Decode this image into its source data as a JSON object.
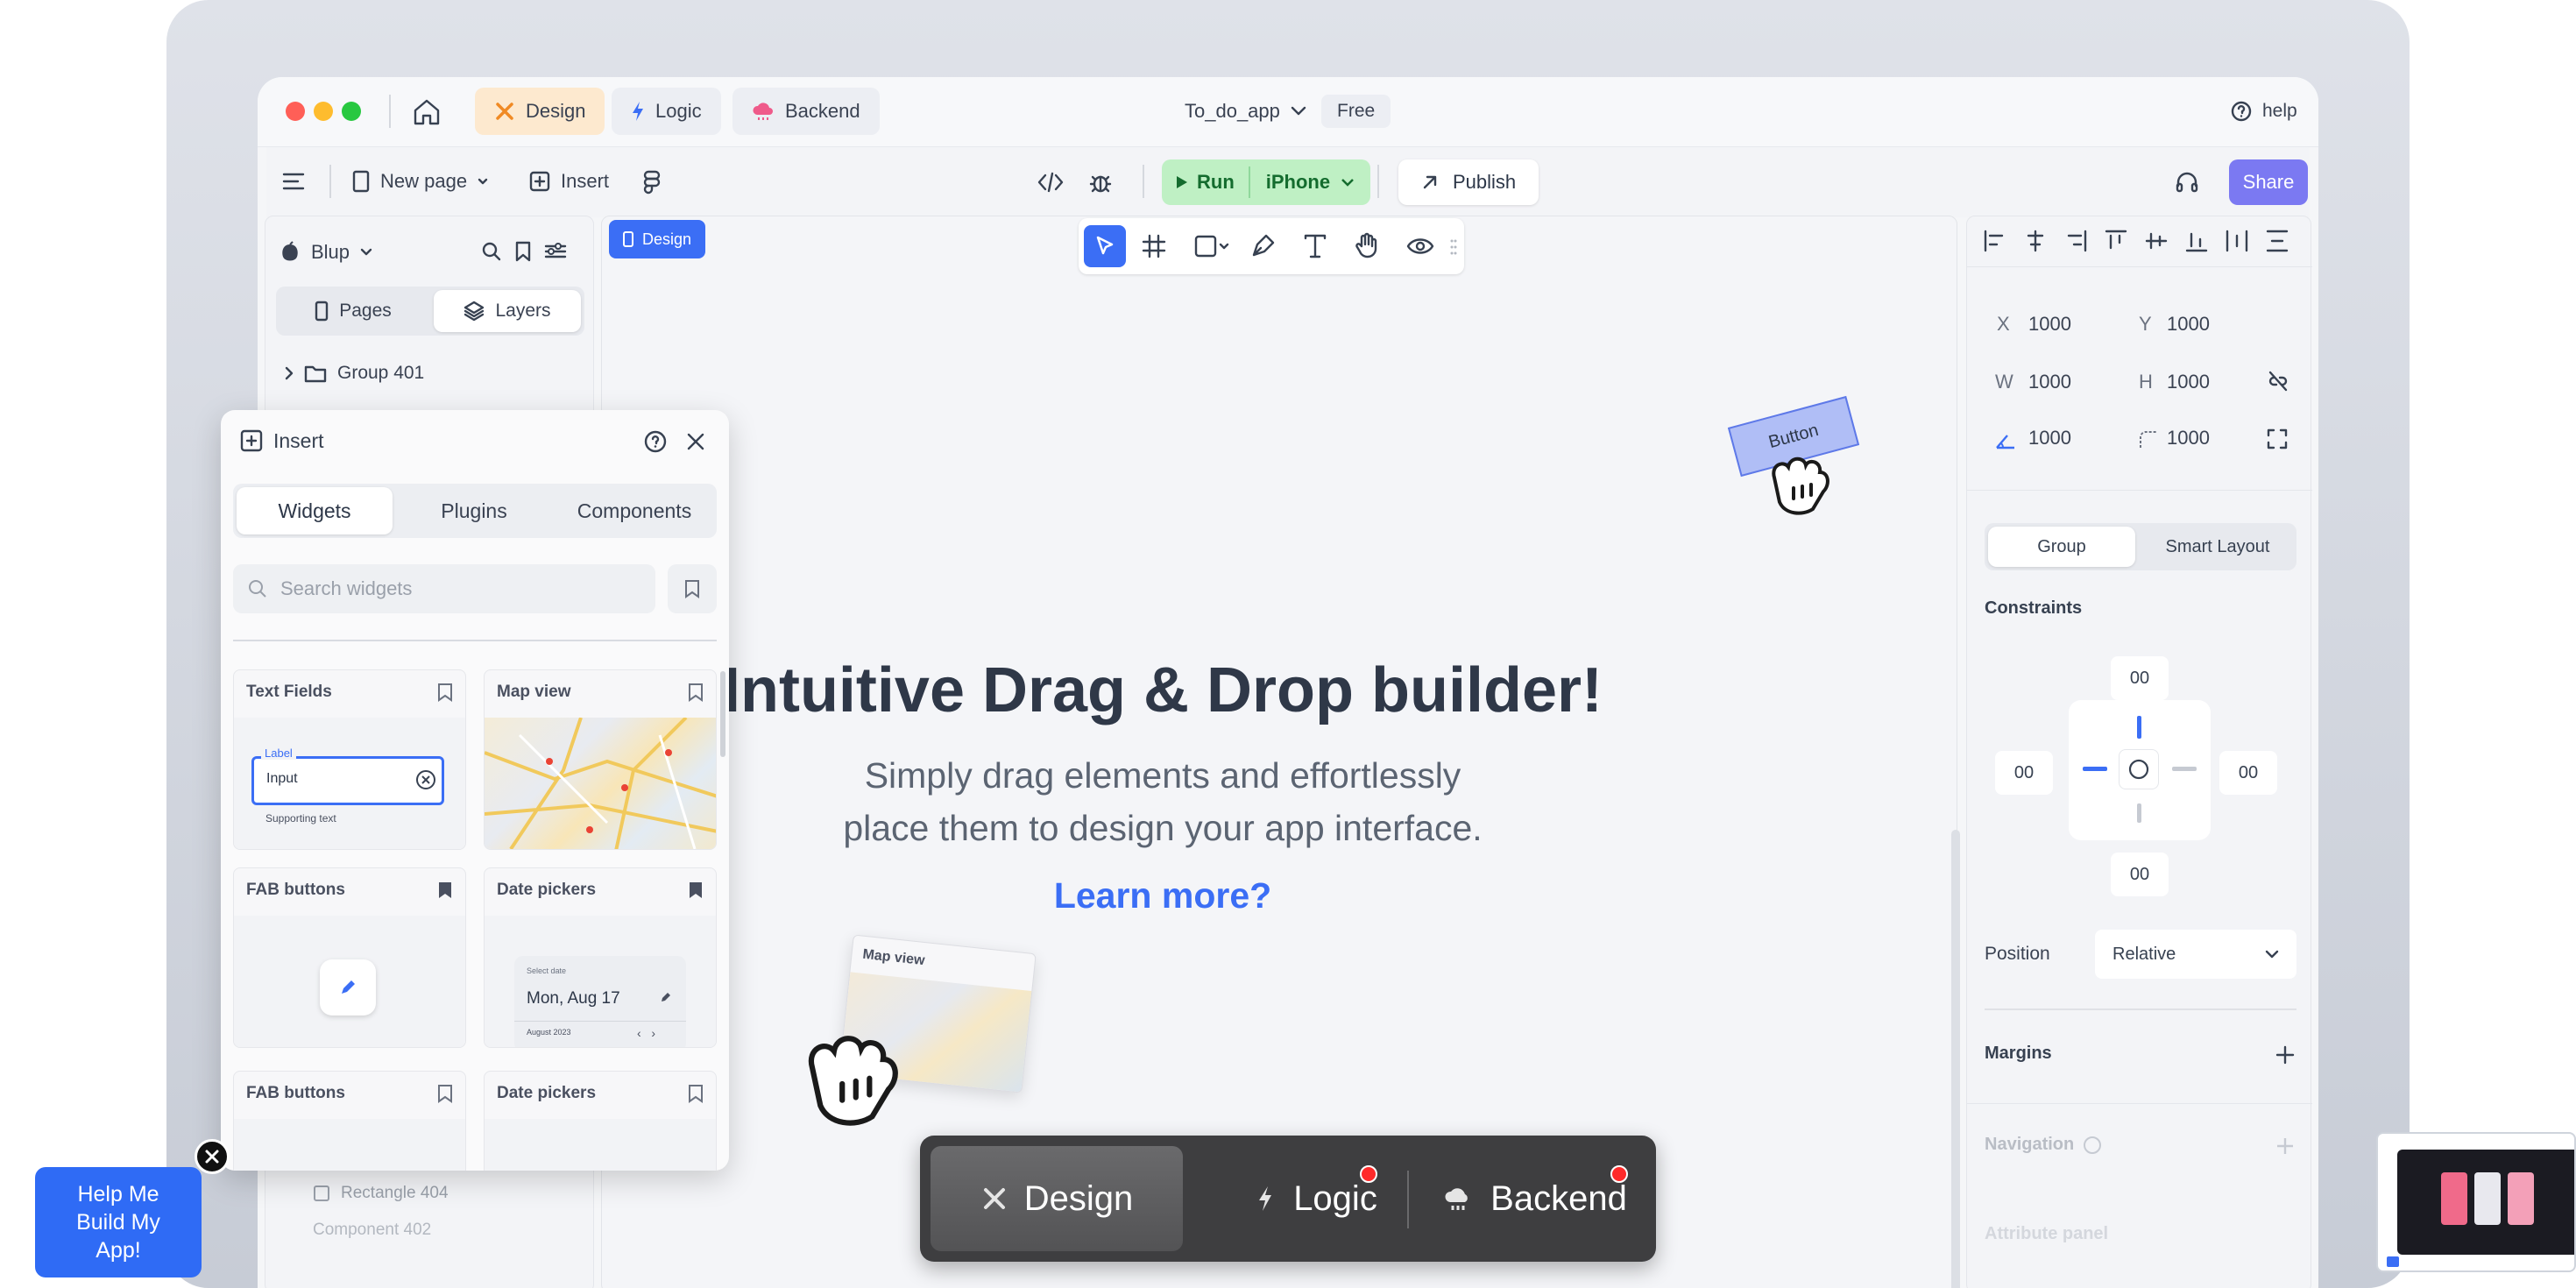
{
  "window": {
    "tabs": [
      {
        "label": "Design",
        "icon": "design-icon"
      },
      {
        "label": "Logic",
        "icon": "bolt-icon"
      },
      {
        "label": "Backend",
        "icon": "cloud-icon"
      }
    ],
    "project_name": "To_do_app",
    "plan_badge": "Free",
    "help_label": "help"
  },
  "toolbar": {
    "new_page_label": "New page",
    "insert_label": "Insert",
    "run_label": "Run",
    "device_label": "iPhone",
    "publish_label": "Publish",
    "share_label": "Share"
  },
  "left_panel": {
    "workspace": "Blup",
    "tabs": [
      "Pages",
      "Layers"
    ],
    "active_tab": "Layers",
    "layers": [
      "Group 401",
      "Rectangle 404",
      "Component 402"
    ]
  },
  "insert_panel": {
    "title": "Insert",
    "tabs": [
      "Widgets",
      "Plugins",
      "Components"
    ],
    "active_tab": "Widgets",
    "search_placeholder": "Search widgets",
    "cards": [
      {
        "title": "Text Fields",
        "bookmarked": false
      },
      {
        "title": "Map view",
        "bookmarked": false
      },
      {
        "title": "FAB buttons",
        "bookmarked": true
      },
      {
        "title": "Date pickers",
        "bookmarked": true
      },
      {
        "title": "FAB buttons",
        "bookmarked": false
      },
      {
        "title": "Date pickers",
        "bookmarked": false
      }
    ],
    "text_field_preview": {
      "label": "Label",
      "value": "Input",
      "supporting": "Supporting text"
    },
    "date_preview": {
      "caption": "Select date",
      "date": "Mon, Aug 17",
      "month": "August 2023"
    }
  },
  "canvas": {
    "badge": "Design",
    "headline": "Intuitive Drag & Drop builder!",
    "subline_1": "Simply drag elements and effortlessly",
    "subline_2": "place them to design your app interface.",
    "link": "Learn more?",
    "dragged_button_label": "Button",
    "dragged_card_title": "Map view"
  },
  "right_panel": {
    "x_label": "X",
    "x_value": "1000",
    "y_label": "Y",
    "y_value": "1000",
    "w_label": "W",
    "w_value": "1000",
    "h_label": "H",
    "h_value": "1000",
    "rotation_value": "1000",
    "radius_value": "1000",
    "layout_tabs": [
      "Group",
      "Smart Layout"
    ],
    "active_layout_tab": "Group",
    "constraints_label": "Constraints",
    "constraint_values": {
      "top": "00",
      "left": "00",
      "right": "00",
      "bottom": "00"
    },
    "position_label": "Position",
    "position_value": "Relative",
    "margins_label": "Margins",
    "navigation_label": "Navigation",
    "next_section_label": "Attribute panel"
  },
  "mode_switcher": [
    {
      "label": "Design",
      "active": true,
      "notification": false
    },
    {
      "label": "Logic",
      "active": false,
      "notification": true
    },
    {
      "label": "Backend",
      "active": false,
      "notification": true
    }
  ],
  "help_widget": {
    "line1": "Help Me",
    "line2": "Build My",
    "line3": "App!"
  },
  "colors": {
    "accent_blue": "#3b6ef5",
    "run_green": "#bff0c4",
    "share_purple": "#7b79f2",
    "design_tab": "#fde9cf",
    "notification_red": "#ff2a2a"
  }
}
